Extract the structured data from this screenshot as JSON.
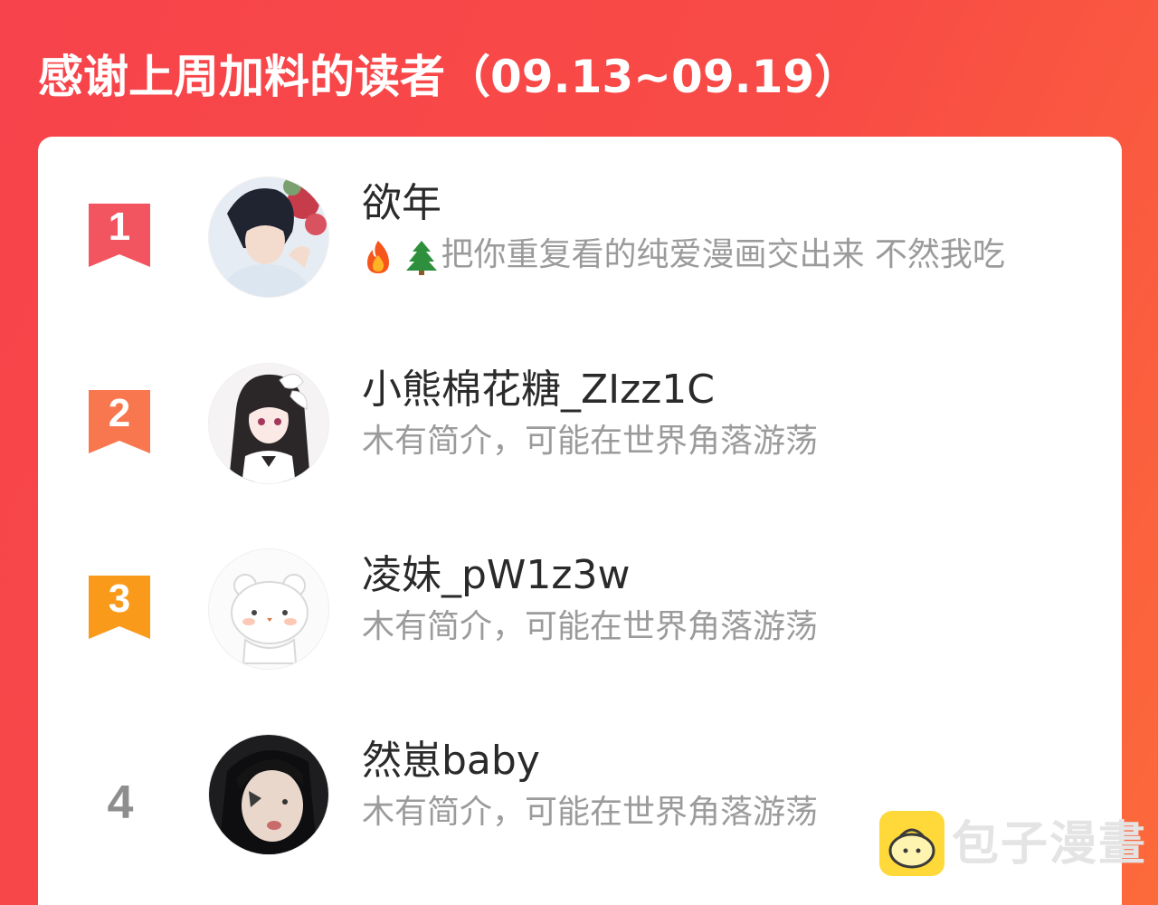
{
  "header": {
    "title": "感谢上周加料的读者（09.13~09.19）"
  },
  "colors": {
    "background_start": "#f7434c",
    "background_end": "#fc6a3a",
    "rank1_flag": "#f2555f",
    "rank2_flag": "#f9774f",
    "rank3_flag": "#f99a1a",
    "rank_plain": "#8e8e8e"
  },
  "readers": [
    {
      "rank": "1",
      "name": "欲年",
      "bio": "把你重复看的纯爱漫画交出来 不然我吃",
      "bio_icons": [
        "fire-emoji-icon",
        "evergreen-tree-emoji-icon"
      ],
      "avatar": "anime-boy-avatar"
    },
    {
      "rank": "2",
      "name": "小熊棉花糖_ZIzz1C",
      "bio": "木有简介，可能在世界角落游荡",
      "avatar": "anime-girl-avatar"
    },
    {
      "rank": "3",
      "name": "凌妹_pW1z3w",
      "bio": "木有简介，可能在世界角落游荡",
      "avatar": "white-bear-avatar"
    },
    {
      "rank": "4",
      "name": "然崽baby",
      "bio": "木有简介，可能在世界角落游荡",
      "avatar": "photo-avatar"
    }
  ],
  "watermark": {
    "text": "包子漫畫",
    "logo_icon": "bun-logo-icon"
  }
}
